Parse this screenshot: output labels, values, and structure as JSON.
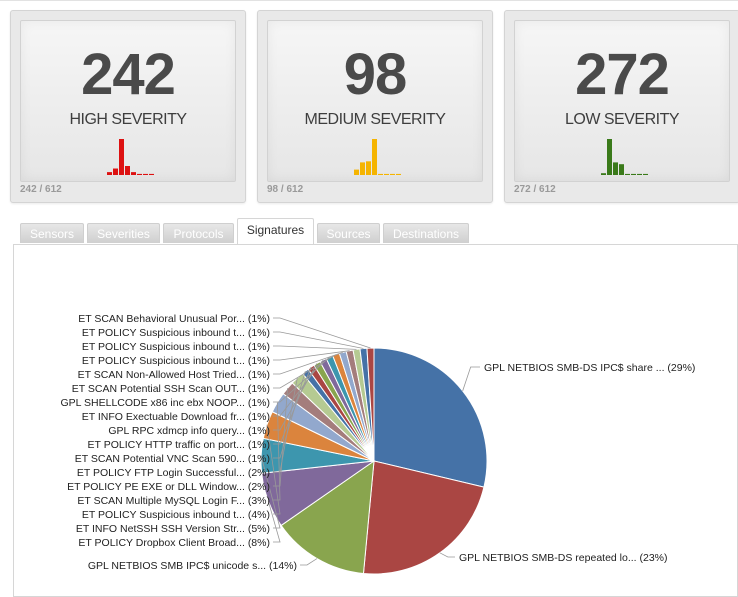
{
  "cards": [
    {
      "count": "242",
      "label": "HIGH SEVERITY",
      "ratio": "242 / 612",
      "color": "#dd1111",
      "spark": [
        0.08,
        0.18,
        1.0,
        0.25,
        0.08,
        0.03,
        0.03,
        0.03
      ]
    },
    {
      "count": "98",
      "label": "MEDIUM SEVERITY",
      "ratio": "98 / 612",
      "color": "#f5b400",
      "spark": [
        0.15,
        0.35,
        0.38,
        1.0,
        0.03,
        0.03,
        0.03,
        0.03
      ]
    },
    {
      "count": "272",
      "label": "LOW SEVERITY",
      "ratio": "272 / 612",
      "color": "#3a7a1a",
      "spark": [
        0.05,
        1.0,
        0.35,
        0.3,
        0.03,
        0.03,
        0.03,
        0.03
      ]
    }
  ],
  "tabs": [
    "Sensors",
    "Severities",
    "Protocols",
    "Signatures",
    "Sources",
    "Destinations"
  ],
  "active_tab": "Signatures",
  "chart_data": {
    "type": "pie",
    "slices": [
      {
        "label": "GPL NETBIOS SMB-DS IPC$ share ... (29%)",
        "value": 29,
        "color": "#4572a7"
      },
      {
        "label": "GPL NETBIOS SMB-DS repeated lo... (23%)",
        "value": 23,
        "color": "#aa4643"
      },
      {
        "label": "GPL NETBIOS SMB IPC$ unicode s... (14%)",
        "value": 14,
        "color": "#89a54e"
      },
      {
        "label": "ET POLICY Dropbox Client Broad... (8%)",
        "value": 8,
        "color": "#80699b"
      },
      {
        "label": "ET INFO NetSSH SSH Version Str... (5%)",
        "value": 5,
        "color": "#3d96ae"
      },
      {
        "label": "ET POLICY Suspicious inbound t... (4%)",
        "value": 4,
        "color": "#db843d"
      },
      {
        "label": "ET SCAN Multiple MySQL Login F... (3%)",
        "value": 3,
        "color": "#92a8cd"
      },
      {
        "label": "ET POLICY PE EXE or DLL Window... (2%)",
        "value": 2,
        "color": "#a47d7c"
      },
      {
        "label": "ET POLICY FTP Login Successful... (2%)",
        "value": 2,
        "color": "#b5ca92"
      },
      {
        "label": "ET SCAN Potential VNC Scan 590... (1%)",
        "value": 1,
        "color": "#4572a7"
      },
      {
        "label": "ET POLICY HTTP traffic on port... (1%)",
        "value": 1,
        "color": "#aa4643"
      },
      {
        "label": "GPL RPC xdmcp info query... (1%)",
        "value": 1,
        "color": "#89a54e"
      },
      {
        "label": "ET INFO Exectuable Download fr... (1%)",
        "value": 1,
        "color": "#80699b"
      },
      {
        "label": "GPL SHELLCODE x86 inc ebx NOOP... (1%)",
        "value": 1,
        "color": "#3d96ae"
      },
      {
        "label": "ET SCAN Potential SSH Scan OUT... (1%)",
        "value": 1,
        "color": "#db843d"
      },
      {
        "label": "ET SCAN Non-Allowed Host Tried... (1%)",
        "value": 1,
        "color": "#92a8cd"
      },
      {
        "label": "ET POLICY Suspicious inbound t... (1%)",
        "value": 1,
        "color": "#a47d7c"
      },
      {
        "label": "ET POLICY Suspicious inbound t... (1%)",
        "value": 1,
        "color": "#b5ca92"
      },
      {
        "label": "ET POLICY Suspicious inbound t... (1%)",
        "value": 1,
        "color": "#4572a7"
      },
      {
        "label": "ET SCAN Behavioral Unusual Por... (1%)",
        "value": 1,
        "color": "#aa4643"
      }
    ]
  }
}
